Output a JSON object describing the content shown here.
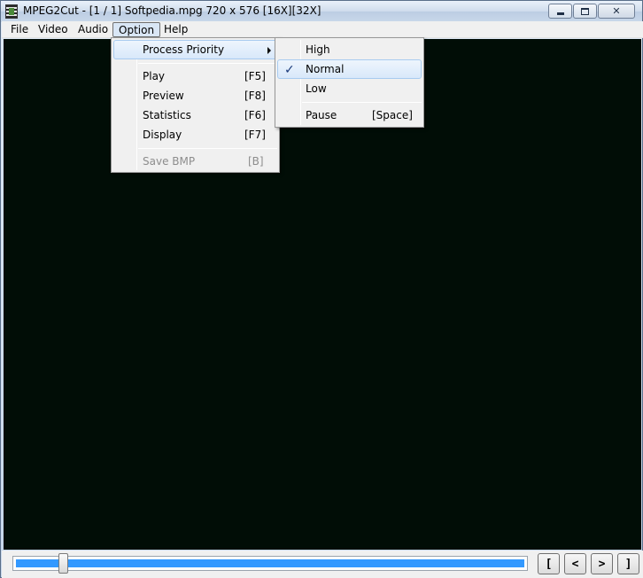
{
  "window": {
    "title": "MPEG2Cut - [1 / 1] Softpedia.mpg 720 x 576 [16X][32X]",
    "close_glyph": "✕"
  },
  "menubar": {
    "items": [
      "File",
      "Video",
      "Audio",
      "Option",
      "Help"
    ],
    "open_item": "Option"
  },
  "option_menu": {
    "items": [
      {
        "label": "Process Priority",
        "shortcut": "",
        "submenu": true,
        "highlighted": true
      },
      {
        "label": "Play",
        "shortcut": "[F5]"
      },
      {
        "label": "Preview",
        "shortcut": "[F8]"
      },
      {
        "label": "Statistics",
        "shortcut": "[F6]"
      },
      {
        "label": "Display",
        "shortcut": "[F7]"
      },
      {
        "label": "Save BMP",
        "shortcut": "[B]",
        "disabled": true
      }
    ]
  },
  "priority_submenu": {
    "items": [
      {
        "label": "High",
        "checked": false
      },
      {
        "label": "Normal",
        "checked": true,
        "highlighted": true
      },
      {
        "label": "Low",
        "checked": false
      },
      {
        "label": "Pause",
        "shortcut": "[Space]"
      }
    ],
    "check_glyph": "✓"
  },
  "navigation": {
    "buttons": [
      "[",
      "<",
      ">",
      "]"
    ]
  },
  "timeline": {
    "position": 0.09
  },
  "colors": {
    "video_background": "#010d06",
    "slider_fill": "#3399ff"
  },
  "icons": [
    "app-icon",
    "minimize-icon",
    "maximize-icon",
    "close-icon",
    "submenu-arrow-icon",
    "check-icon"
  ]
}
